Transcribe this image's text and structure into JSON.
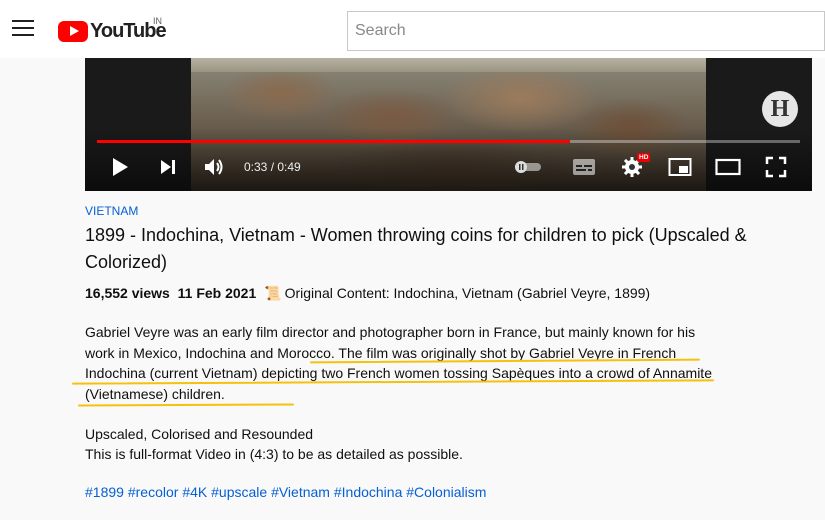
{
  "header": {
    "brand": "YouTube",
    "country": "IN",
    "search_placeholder": "Search"
  },
  "player": {
    "current_time": "0:33",
    "separator": " / ",
    "duration": "0:49",
    "progress_fraction": 0.673,
    "channel_badge": "H",
    "settings_badge": "HD"
  },
  "video": {
    "category": "VIETNAM",
    "title": "1899 - Indochina, Vietnam - Women throwing coins for children to pick (Upscaled & Colorized)",
    "views": "16,552 views",
    "date": "11 Feb 2021",
    "credit": "Original Content:  Indochina, Vietnam (Gabriel Veyre, 1899)"
  },
  "description": {
    "paragraph1": "Gabriel Veyre was an early film director and photographer born in France, but mainly known for his work in Mexico, Indochina and Morocco. The film was originally shot by Gabriel Veyre in French Indochina (current Vietnam) depicting two French women tossing Sapèques into a crowd of Annamite (Vietnamese) children.",
    "line2": "Upscaled, Colorised and Resounded",
    "line3": "This is full-format Video in (4:3) to be as detailed as possible."
  },
  "hashtags": [
    "#1899",
    "#recolor",
    "#4K",
    "#upscale",
    "#Vietnam",
    "#Indochina",
    "#Colonialism"
  ],
  "colors": {
    "brand_red": "#ff0000",
    "link_blue": "#065fd4",
    "highlight_yellow": "#f4c20d"
  }
}
